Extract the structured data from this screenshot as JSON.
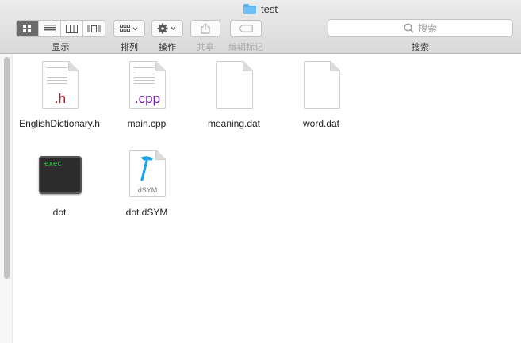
{
  "window": {
    "title": "test"
  },
  "toolbar": {
    "view_label": "显示",
    "arrange_label": "排列",
    "action_label": "操作",
    "share_label": "共享",
    "tags_label": "编辑标记",
    "search_placeholder": "搜索",
    "search_label": "搜索"
  },
  "files": [
    {
      "name": "EnglishDictionary.h",
      "kind": "h",
      "ext": ".h",
      "ext_color": "#c0181b"
    },
    {
      "name": "main.cpp",
      "kind": "cpp",
      "ext": ".cpp",
      "ext_color": "#6a1e9c"
    },
    {
      "name": "meaning.dat",
      "kind": "blank"
    },
    {
      "name": "word.dat",
      "kind": "blank"
    },
    {
      "name": "dot",
      "kind": "exec",
      "badge": "exec"
    },
    {
      "name": "dot.dSYM",
      "kind": "dsym",
      "badge": "dSYM"
    }
  ],
  "colors": {
    "accent": "#1aa6e6",
    "folder": "#57b2f0"
  }
}
